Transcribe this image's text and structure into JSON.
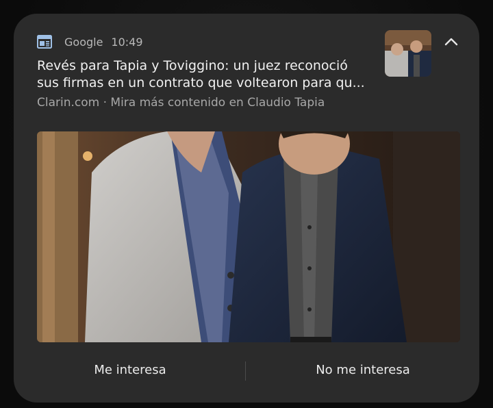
{
  "notification": {
    "app_name": "Google",
    "time": "10:49",
    "title_line1": "Revés para Tapia y Toviggino: un juez reconoció",
    "title_line2": "sus firmas en un contrato que voltearon para qu...",
    "source": "Clarin.com · Mira más contenido en Claudio Tapia",
    "app_icon": "news-icon",
    "expand_icon": "chevron-up-icon"
  },
  "actions": {
    "interested": "Me interesa",
    "not_interested": "No me interesa"
  }
}
